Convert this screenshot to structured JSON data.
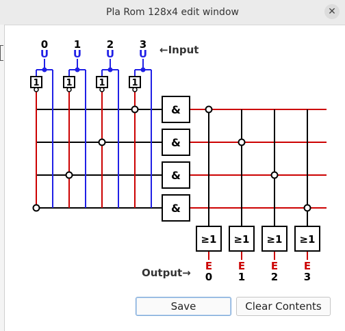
{
  "window": {
    "title": "Pla Rom 128x4 edit window",
    "close_glyph": "✕"
  },
  "diagram": {
    "input_label": "←Input",
    "output_label": "Output→",
    "inputs": [
      {
        "index": "0",
        "marker": "U"
      },
      {
        "index": "1",
        "marker": "U"
      },
      {
        "index": "2",
        "marker": "U"
      },
      {
        "index": "3",
        "marker": "U"
      }
    ],
    "buffer_label": "1",
    "and_label": "&",
    "or_label": "≥1",
    "outputs": [
      {
        "index": "0",
        "marker": "E"
      },
      {
        "index": "1",
        "marker": "E"
      },
      {
        "index": "2",
        "marker": "E"
      },
      {
        "index": "3",
        "marker": "E"
      }
    ],
    "and_connections": [
      {
        "row": 0,
        "input": 3,
        "inverted": true
      },
      {
        "row": 1,
        "input": 2,
        "inverted": true
      },
      {
        "row": 2,
        "input": 1,
        "inverted": true
      },
      {
        "row": 3,
        "input": 0,
        "inverted": true
      }
    ],
    "or_connections": [
      {
        "row": 0,
        "output": 0
      },
      {
        "row": 1,
        "output": 1
      },
      {
        "row": 2,
        "output": 2
      },
      {
        "row": 3,
        "output": 3
      }
    ],
    "colors": {
      "input_wire": "#1f1fe6",
      "inverted_wire": "#cc0000",
      "and_line": "#000000",
      "or_line": "#cc0000",
      "marker_in": "#1f1fe6",
      "marker_out": "#cc0000"
    }
  },
  "buttons": {
    "save": "Save",
    "clear": "Clear Contents"
  }
}
